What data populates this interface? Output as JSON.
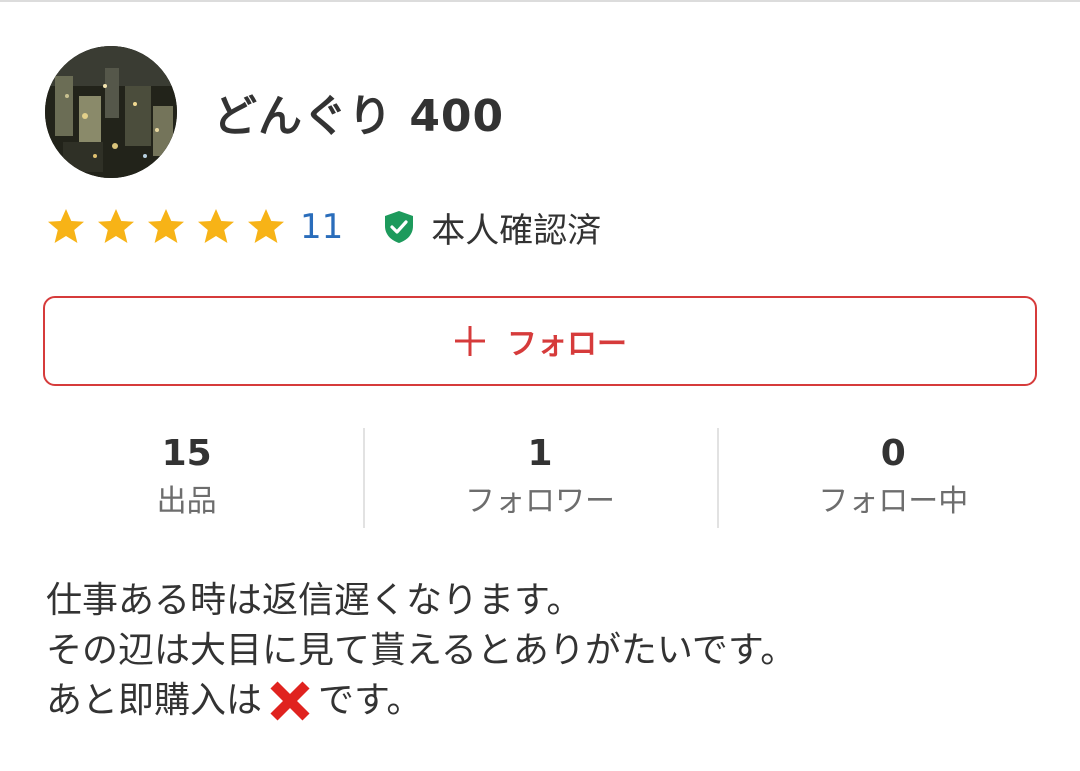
{
  "profile": {
    "username": "どんぐり 400",
    "avatar_icon": "city-night-photo"
  },
  "rating": {
    "stars": 5,
    "max_stars": 5,
    "review_count": "11",
    "star_color": "#f7b317",
    "count_color": "#2a6dbb"
  },
  "verification": {
    "label": "本人確認済",
    "icon": "shield-check-icon",
    "color": "#1d9a5c"
  },
  "follow_button": {
    "icon": "plus-icon",
    "label": "フォロー",
    "accent_color": "#d63b3b"
  },
  "stats": [
    {
      "value": "15",
      "label": "出品"
    },
    {
      "value": "1",
      "label": "フォロワー"
    },
    {
      "value": "0",
      "label": "フォロー中"
    }
  ],
  "bio": {
    "line1": "仕事ある時は返信遅くなります。",
    "line2": "その辺は大目に見て貰えるとありがたいです。",
    "line3_before": "あと即購入は",
    "line3_emoji": "cross-mark-icon",
    "line3_after": "です。"
  }
}
